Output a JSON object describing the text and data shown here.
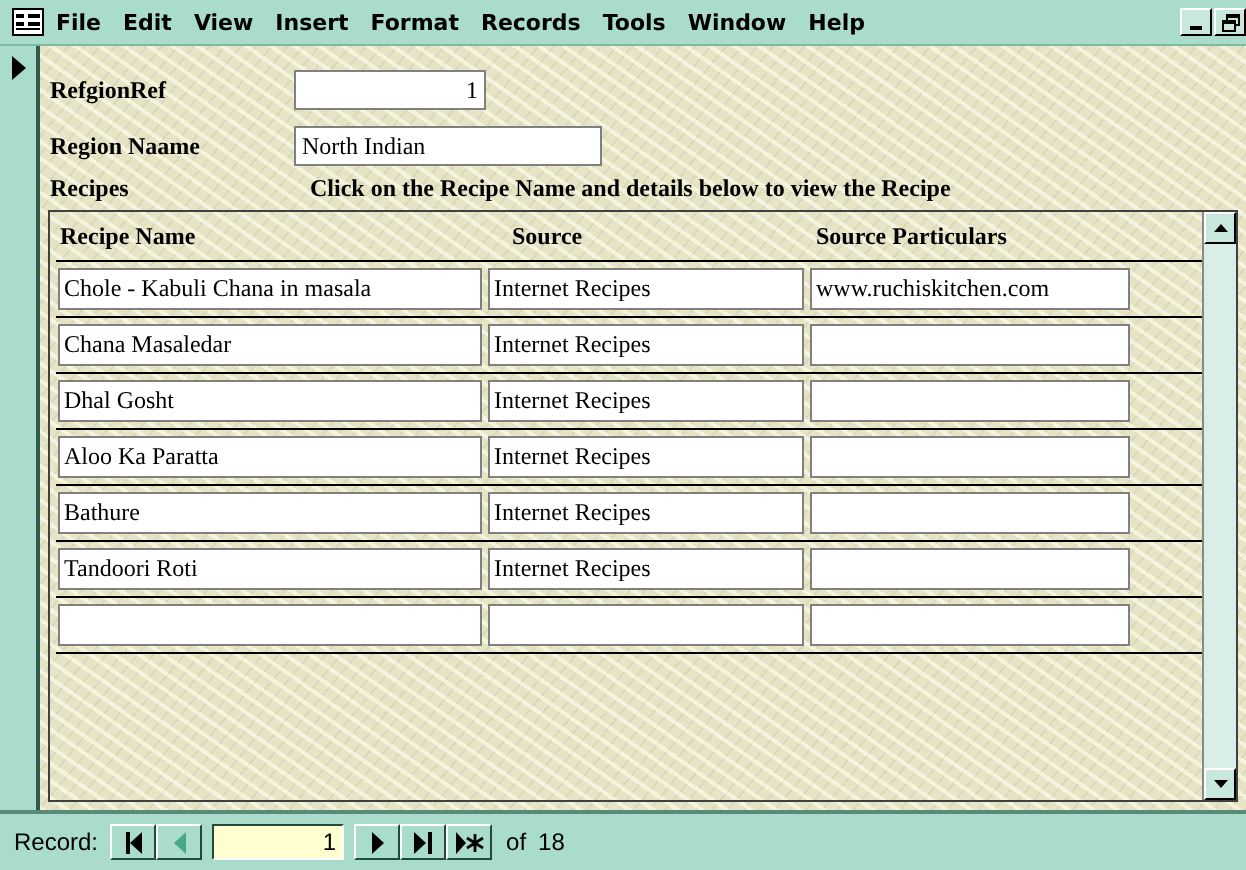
{
  "menu": [
    "File",
    "Edit",
    "View",
    "Insert",
    "Format",
    "Records",
    "Tools",
    "Window",
    "Help"
  ],
  "form": {
    "fields": [
      {
        "label": "RefgionRef",
        "value": "1",
        "kind": "number"
      },
      {
        "label": "Region Naame",
        "value": "North Indian",
        "kind": "text"
      }
    ],
    "recipes_label": "Recipes",
    "instruction": "Click on the Recipe Name  and details below to view the Recipe"
  },
  "subform": {
    "columns": [
      "Recipe Name",
      "Source",
      "Source Particulars"
    ],
    "rows": [
      {
        "kind": "record",
        "cells": [
          "Chole - Kabuli Chana in masala",
          "Internet Recipes",
          "www.ruchiskitchen.com"
        ]
      },
      {
        "kind": "record",
        "cells": [
          "Chana Masaledar",
          "Internet Recipes",
          ""
        ]
      },
      {
        "kind": "record",
        "cells": [
          "Dhal Gosht",
          "Internet Recipes",
          ""
        ]
      },
      {
        "kind": "record",
        "cells": [
          "Aloo Ka Paratta",
          "Internet Recipes",
          ""
        ]
      },
      {
        "kind": "record",
        "cells": [
          "Bathure",
          "Internet Recipes",
          ""
        ]
      },
      {
        "kind": "record",
        "cells": [
          "Tandoori Roti",
          "Internet Recipes",
          ""
        ]
      },
      {
        "kind": "new"
      }
    ]
  },
  "navigator": {
    "label": "Record:",
    "buttons": [
      {
        "kind": "first",
        "disabled": false
      },
      {
        "kind": "prev",
        "disabled": true
      }
    ],
    "current": "1",
    "buttons_after": [
      {
        "kind": "next",
        "disabled": false
      },
      {
        "kind": "last",
        "disabled": false
      },
      {
        "kind": "new",
        "disabled": false
      }
    ],
    "of": "of",
    "total": "18"
  }
}
